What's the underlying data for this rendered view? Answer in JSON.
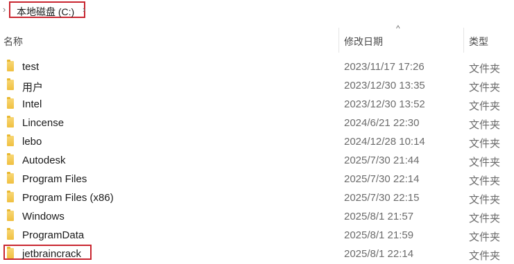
{
  "breadcrumb": {
    "location_label": "本地磁盘 (C:)"
  },
  "columns": {
    "name": "名称",
    "date_modified": "修改日期",
    "type": "类型"
  },
  "rows": [
    {
      "name": "test",
      "date": "2023/11/17 17:26",
      "type": "文件夹"
    },
    {
      "name": "用户",
      "date": "2023/12/30 13:35",
      "type": "文件夹"
    },
    {
      "name": "Intel",
      "date": "2023/12/30 13:52",
      "type": "文件夹"
    },
    {
      "name": "Lincense",
      "date": "2024/6/21 22:30",
      "type": "文件夹"
    },
    {
      "name": "lebo",
      "date": "2024/12/28 10:14",
      "type": "文件夹"
    },
    {
      "name": "Autodesk",
      "date": "2025/7/30 21:44",
      "type": "文件夹"
    },
    {
      "name": "Program Files",
      "date": "2025/7/30 22:14",
      "type": "文件夹"
    },
    {
      "name": "Program Files (x86)",
      "date": "2025/7/30 22:15",
      "type": "文件夹"
    },
    {
      "name": "Windows",
      "date": "2025/8/1 21:57",
      "type": "文件夹"
    },
    {
      "name": "ProgramData",
      "date": "2025/8/1 21:59",
      "type": "文件夹"
    },
    {
      "name": "jetbraincrack",
      "date": "2025/8/1 22:14",
      "type": "文件夹"
    }
  ],
  "colors": {
    "highlight": "#c9252f",
    "folder": "#f0c040"
  }
}
